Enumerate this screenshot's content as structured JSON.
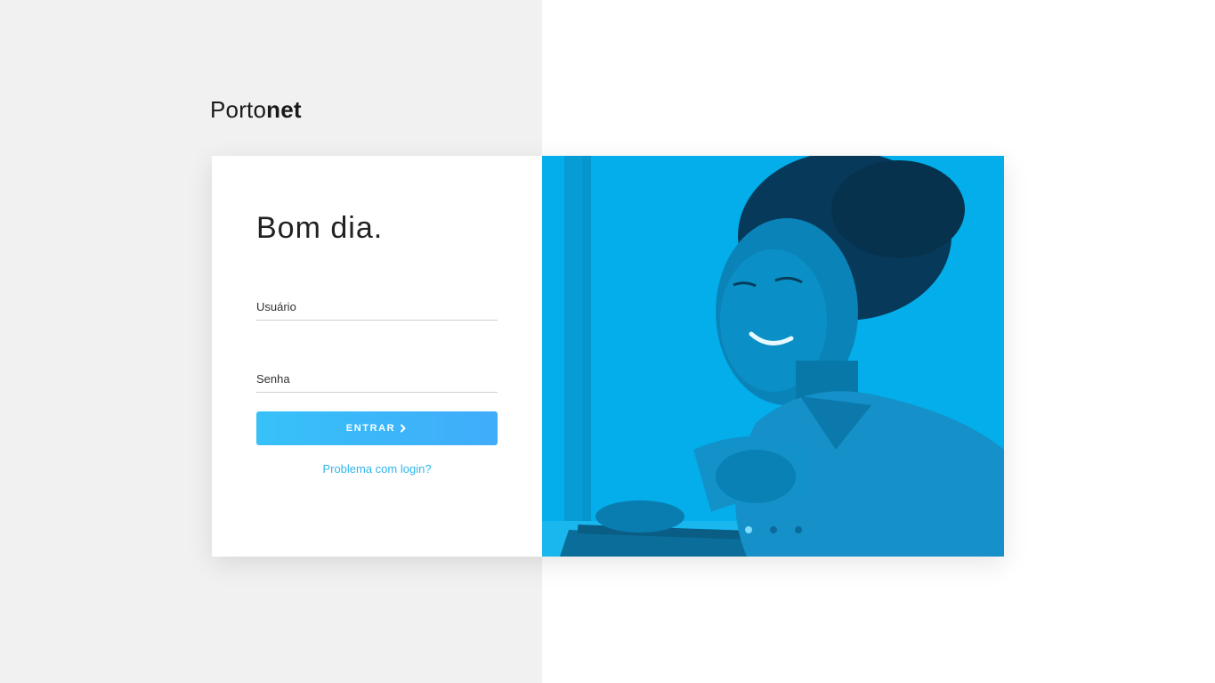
{
  "brand": {
    "name_light": "Porto",
    "name_bold": "net"
  },
  "login": {
    "greeting": "Bom dia.",
    "username_placeholder": "Usuário",
    "password_placeholder": "Senha",
    "submit_label": "ENTRAR",
    "help_link": "Problema com login?"
  },
  "carousel": {
    "slide_count": 3,
    "active_index": 0
  },
  "colors": {
    "accent": "#37c1f8",
    "link": "#2fb6ea",
    "image_tint": "#00b2f0"
  },
  "icons": {
    "button_icon": "chevron-right-icon"
  }
}
